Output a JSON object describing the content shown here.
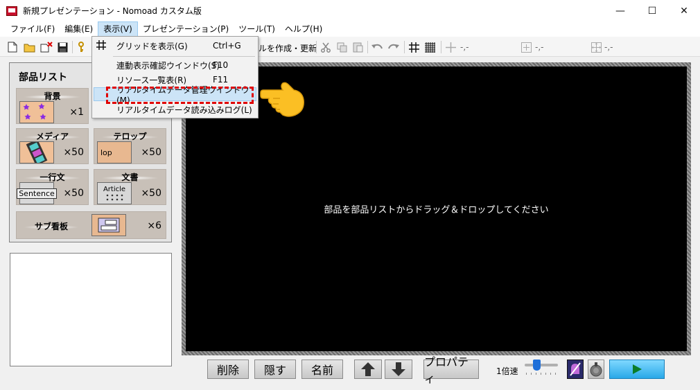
{
  "window": {
    "title": "新規プレゼンテーション - Nomoad カスタム版",
    "minimize": "—",
    "maximize": "☐",
    "close": "✕"
  },
  "menubar": [
    {
      "label": "ファイル(F)"
    },
    {
      "label": "編集(E)"
    },
    {
      "label": "表示(V)"
    },
    {
      "label": "プレゼンテーション(P)"
    },
    {
      "label": "ツール(T)"
    },
    {
      "label": "ヘルプ(H)"
    }
  ],
  "toolbar": {
    "update_label": "ルを作成・更新",
    "coord1": "-,-",
    "coord2": "-,-",
    "coord3": "-,-"
  },
  "view_menu": {
    "items": [
      {
        "label": "グリッドを表示(G)",
        "shortcut": "Ctrl+G"
      },
      {
        "label": "連動表示確認ウインドウ(S)",
        "shortcut": "F10"
      },
      {
        "label": "リソース一覧表(R)",
        "shortcut": "F11"
      },
      {
        "label": "リアルタイムデータ管理ウインドウ(M)",
        "shortcut": ""
      },
      {
        "label": "リアルタイムデータ読み込みログ(L)",
        "shortcut": ""
      }
    ]
  },
  "parts_list": {
    "title": "部品リスト",
    "parts": [
      {
        "label": "背景",
        "count": "×1"
      },
      {
        "label": "メディア",
        "count": "×50"
      },
      {
        "label": "テロップ",
        "count": "×50",
        "thumb": "lop"
      },
      {
        "label": "一行文",
        "count": "×50",
        "thumb": "Sentence"
      },
      {
        "label": "文書",
        "count": "×50",
        "thumb": "Article"
      },
      {
        "label": "サブ看板",
        "count": "×6"
      }
    ]
  },
  "stage": {
    "message": "部品を部品リストからドラッグ＆ドロップしてください"
  },
  "bottom_bar": {
    "delete": "削除",
    "hide": "隠す",
    "name": "名前",
    "properties": "プロパティ",
    "speed_label": "1倍速"
  },
  "colors": {
    "highlight_bg": "#cce4f7",
    "dashed_border": "#e00000",
    "stage_bg": "#000000",
    "play_button": "#29a8e8"
  }
}
